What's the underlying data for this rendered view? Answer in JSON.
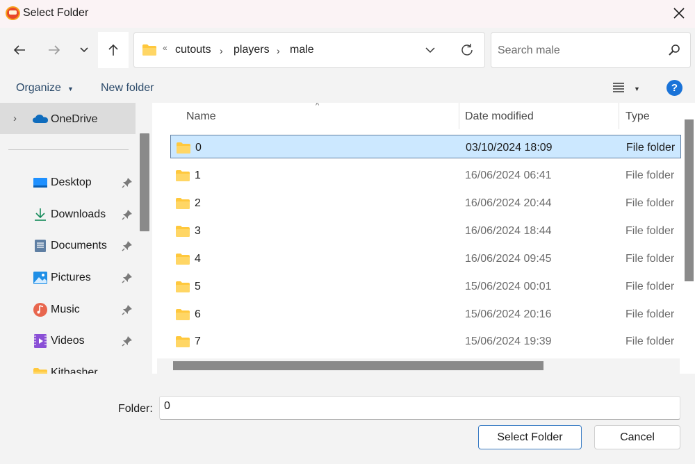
{
  "window": {
    "title": "Select Folder"
  },
  "nav": {
    "breadcrumb_overflow": "«",
    "breadcrumbs": [
      "cutouts",
      "players",
      "male"
    ],
    "search_placeholder": "Search male"
  },
  "commands": {
    "organize": "Organize",
    "new_folder": "New folder",
    "help": "?"
  },
  "sidebar": {
    "onedrive": "OneDrive",
    "items": [
      {
        "label": "Desktop",
        "icon": "desktop-icon"
      },
      {
        "label": "Downloads",
        "icon": "downloads-icon"
      },
      {
        "label": "Documents",
        "icon": "documents-icon"
      },
      {
        "label": "Pictures",
        "icon": "pictures-icon"
      },
      {
        "label": "Music",
        "icon": "music-icon"
      },
      {
        "label": "Videos",
        "icon": "videos-icon"
      },
      {
        "label": "Kitbasher",
        "icon": "folder-icon"
      }
    ]
  },
  "filelist": {
    "columns": {
      "name": "Name",
      "date": "Date modified",
      "type": "Type"
    },
    "rows": [
      {
        "name": "0",
        "date": "03/10/2024 18:09",
        "type": "File folder",
        "selected": true
      },
      {
        "name": "1",
        "date": "16/06/2024 06:41",
        "type": "File folder"
      },
      {
        "name": "2",
        "date": "16/06/2024 20:44",
        "type": "File folder"
      },
      {
        "name": "3",
        "date": "16/06/2024 18:44",
        "type": "File folder"
      },
      {
        "name": "4",
        "date": "16/06/2024 09:45",
        "type": "File folder"
      },
      {
        "name": "5",
        "date": "15/06/2024 00:01",
        "type": "File folder"
      },
      {
        "name": "6",
        "date": "15/06/2024 20:16",
        "type": "File folder"
      },
      {
        "name": "7",
        "date": "15/06/2024 19:39",
        "type": "File folder"
      }
    ]
  },
  "footer": {
    "folder_label": "Folder:",
    "folder_value": "0",
    "select_button": "Select Folder",
    "cancel_button": "Cancel"
  },
  "colors": {
    "selection_bg": "#cce8ff",
    "accent": "#1a73d8",
    "folder_yellow": "#ffc83d"
  }
}
